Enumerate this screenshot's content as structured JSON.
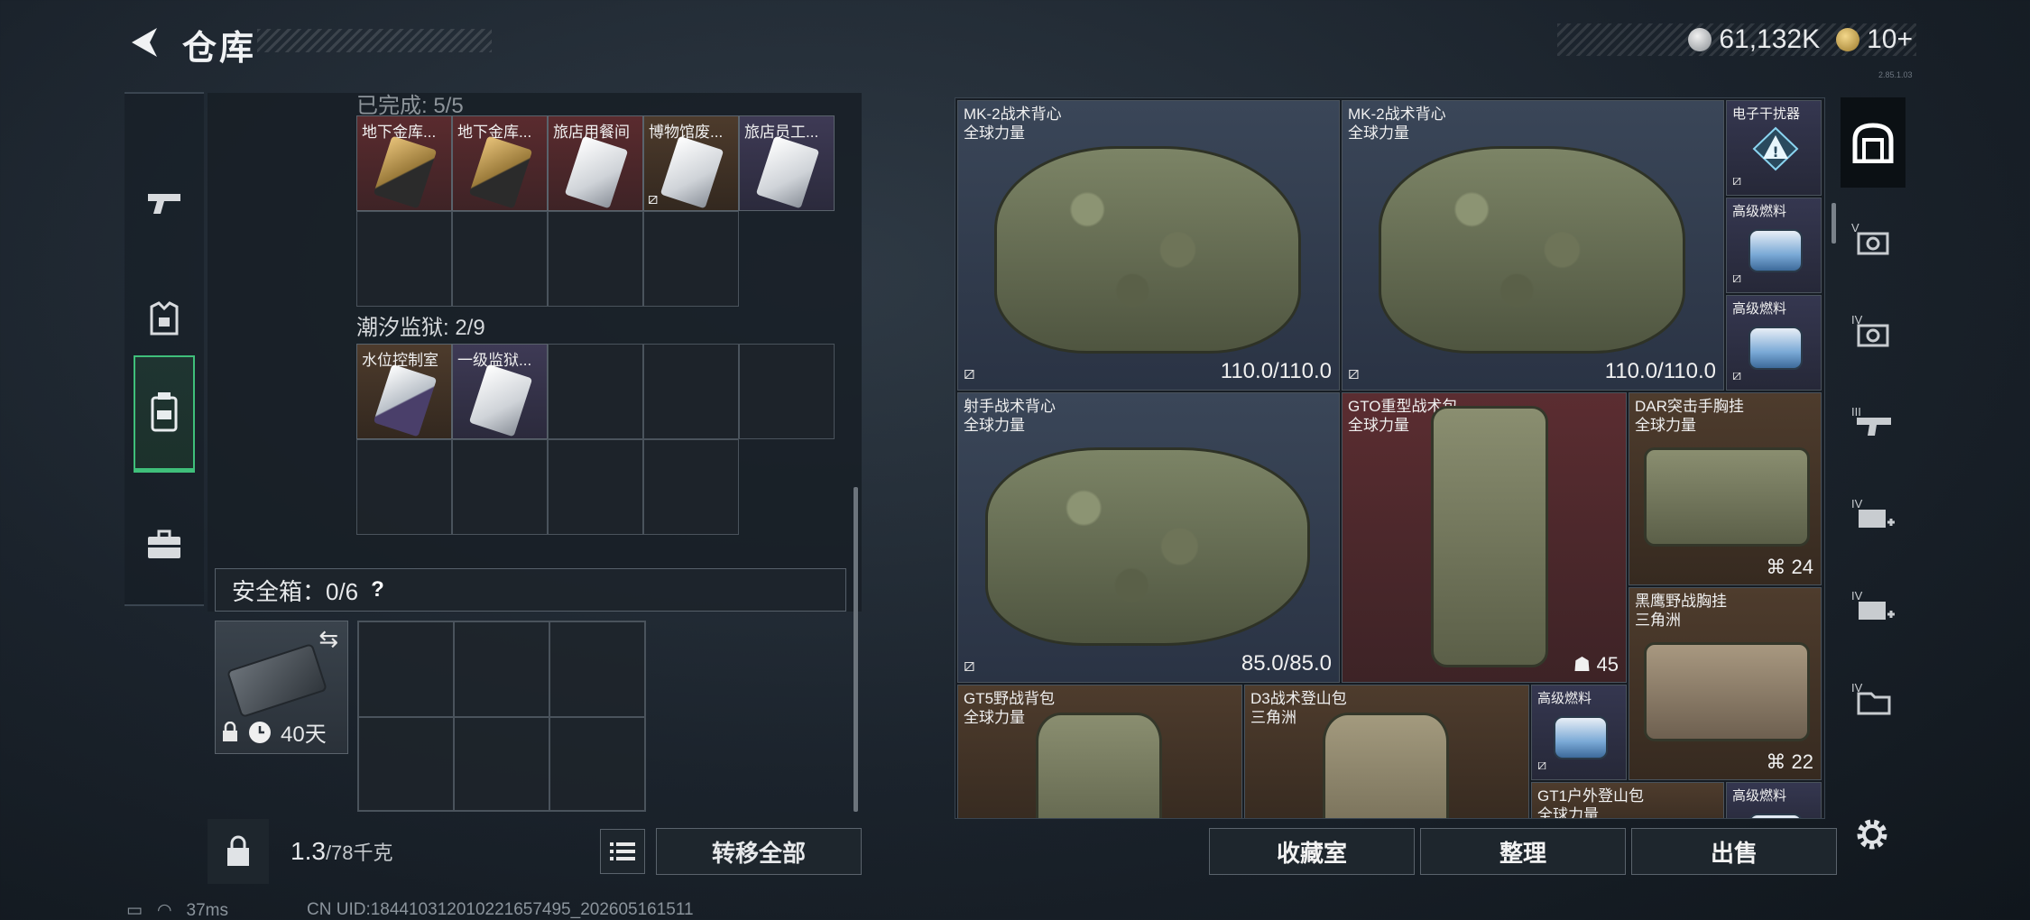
{
  "header": {
    "title": "仓库",
    "currency_silver": "61,132K",
    "currency_gold": "10+",
    "version": "2.85.1.03"
  },
  "left_nav": {
    "items": [
      {
        "icon": "pistol-icon"
      },
      {
        "icon": "armor-icon"
      },
      {
        "icon": "backpack-icon"
      },
      {
        "icon": "briefcase-icon"
      }
    ]
  },
  "stash": {
    "section1_partial_label": "已完成: 5/5",
    "section1_items": [
      {
        "name": "地下金库...",
        "rarity": "red"
      },
      {
        "name": "地下金库...",
        "rarity": "red"
      },
      {
        "name": "旅店用餐间",
        "rarity": "red"
      },
      {
        "name": "博物馆废...",
        "rarity": "brown"
      },
      {
        "name": "旅店员工...",
        "rarity": "purple"
      }
    ],
    "section2_label": "潮汐监狱: 2/9",
    "section2_items": [
      {
        "name": "水位控制室",
        "rarity": "brown"
      },
      {
        "name": "一级监狱...",
        "rarity": "purple"
      }
    ],
    "safe_label": "安全箱：0/6",
    "safe_help": "?",
    "safe_time": "40天",
    "weight_current": "1.3",
    "weight_max": "/78千克",
    "transfer_all": "转移全部"
  },
  "inventory": {
    "items": [
      {
        "name": "MK-2战术背心",
        "sub": "全球力量",
        "durability": "110.0/110.0"
      },
      {
        "name": "MK-2战术背心",
        "sub": "全球力量",
        "durability": "110.0/110.0"
      },
      {
        "name": "电子干扰器",
        "sub": ""
      },
      {
        "name": "高级燃料",
        "sub": ""
      },
      {
        "name": "高级燃料",
        "sub": ""
      },
      {
        "name": "射手战术背心",
        "sub": "全球力量",
        "durability": "85.0/85.0"
      },
      {
        "name": "GTO重型战术包",
        "sub": "全球力量",
        "count": "45"
      },
      {
        "name": "DAR突击手胸挂",
        "sub": "全球力量",
        "count": "24"
      },
      {
        "name": "黑鹰野战胸挂",
        "sub": "三角洲",
        "count": "22"
      },
      {
        "name": "GT5野战背包",
        "sub": "全球力量"
      },
      {
        "name": "D3战术登山包",
        "sub": "三角洲"
      },
      {
        "name": "高级燃料",
        "sub": ""
      },
      {
        "name": "GT1户外登山包",
        "sub": "全球力量"
      },
      {
        "name": "高级燃料",
        "sub": ""
      }
    ]
  },
  "right_nav": {
    "items": [
      {
        "label": ""
      },
      {
        "label": "V"
      },
      {
        "label": "IV"
      },
      {
        "label": "III"
      },
      {
        "label": "IV"
      },
      {
        "label": "IV"
      },
      {
        "label": "IV"
      }
    ]
  },
  "buttons": {
    "collection": "收藏室",
    "organize": "整理",
    "sell": "出售"
  },
  "status": {
    "ping": "37ms",
    "uid": "CN UID:184410312010221657495_202605161511"
  }
}
